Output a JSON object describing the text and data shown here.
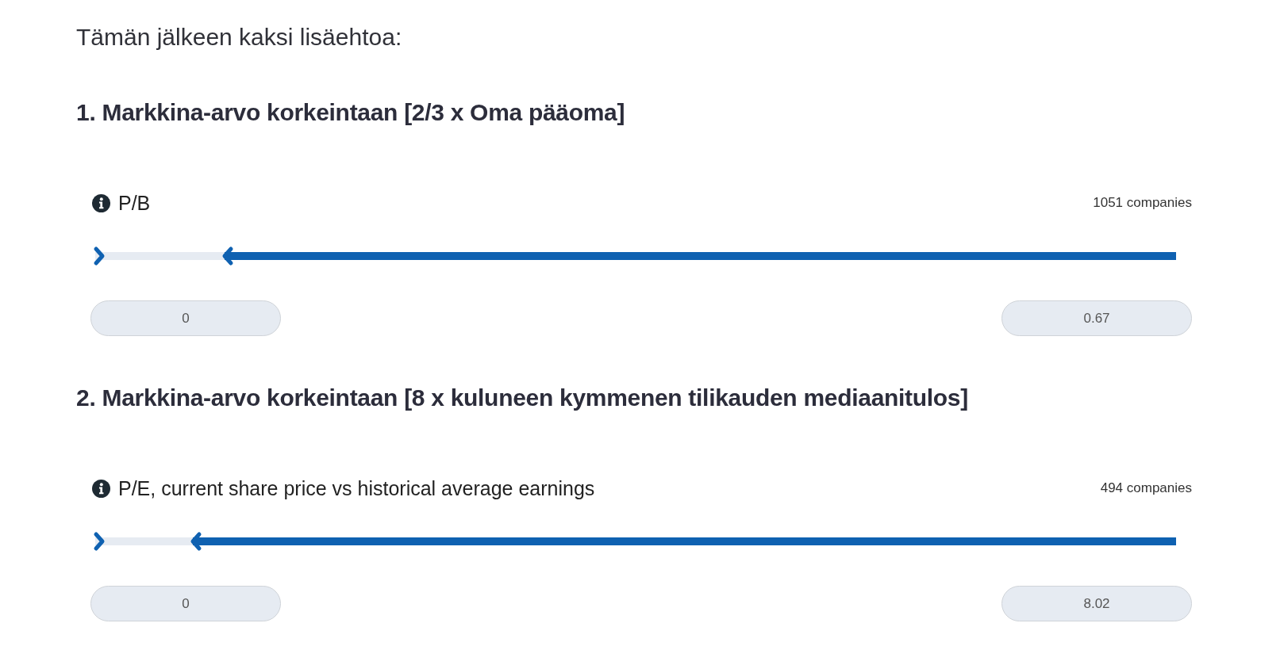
{
  "intro": "Tämän jälkeen kaksi lisäehtoa:",
  "conditions": [
    {
      "heading": "1. Markkina-arvo korkeintaan [2/3 x Oma pääoma]",
      "filter": {
        "label": "P/B",
        "count": "1051 companies",
        "slider": {
          "level": 0.88
        },
        "min_value": "0",
        "max_value": "0.67"
      }
    },
    {
      "heading": "2. Markkina-arvo korkeintaan [8 x kuluneen kymmenen tilikauden mediaanitulos]",
      "filter": {
        "label": "P/E, current share price vs historical average earnings",
        "count": "494 companies",
        "slider": {
          "level": 0.91
        },
        "min_value": "0",
        "max_value": "8.02"
      }
    }
  ]
}
